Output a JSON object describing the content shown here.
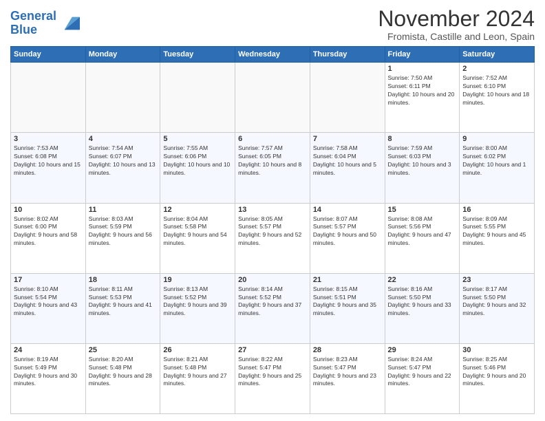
{
  "header": {
    "logo_line1": "General",
    "logo_line2": "Blue",
    "month": "November 2024",
    "location": "Fromista, Castille and Leon, Spain"
  },
  "weekdays": [
    "Sunday",
    "Monday",
    "Tuesday",
    "Wednesday",
    "Thursday",
    "Friday",
    "Saturday"
  ],
  "weeks": [
    [
      {
        "day": "",
        "info": ""
      },
      {
        "day": "",
        "info": ""
      },
      {
        "day": "",
        "info": ""
      },
      {
        "day": "",
        "info": ""
      },
      {
        "day": "",
        "info": ""
      },
      {
        "day": "1",
        "info": "Sunrise: 7:50 AM\nSunset: 6:11 PM\nDaylight: 10 hours and 20 minutes."
      },
      {
        "day": "2",
        "info": "Sunrise: 7:52 AM\nSunset: 6:10 PM\nDaylight: 10 hours and 18 minutes."
      }
    ],
    [
      {
        "day": "3",
        "info": "Sunrise: 7:53 AM\nSunset: 6:08 PM\nDaylight: 10 hours and 15 minutes."
      },
      {
        "day": "4",
        "info": "Sunrise: 7:54 AM\nSunset: 6:07 PM\nDaylight: 10 hours and 13 minutes."
      },
      {
        "day": "5",
        "info": "Sunrise: 7:55 AM\nSunset: 6:06 PM\nDaylight: 10 hours and 10 minutes."
      },
      {
        "day": "6",
        "info": "Sunrise: 7:57 AM\nSunset: 6:05 PM\nDaylight: 10 hours and 8 minutes."
      },
      {
        "day": "7",
        "info": "Sunrise: 7:58 AM\nSunset: 6:04 PM\nDaylight: 10 hours and 5 minutes."
      },
      {
        "day": "8",
        "info": "Sunrise: 7:59 AM\nSunset: 6:03 PM\nDaylight: 10 hours and 3 minutes."
      },
      {
        "day": "9",
        "info": "Sunrise: 8:00 AM\nSunset: 6:02 PM\nDaylight: 10 hours and 1 minute."
      }
    ],
    [
      {
        "day": "10",
        "info": "Sunrise: 8:02 AM\nSunset: 6:00 PM\nDaylight: 9 hours and 58 minutes."
      },
      {
        "day": "11",
        "info": "Sunrise: 8:03 AM\nSunset: 5:59 PM\nDaylight: 9 hours and 56 minutes."
      },
      {
        "day": "12",
        "info": "Sunrise: 8:04 AM\nSunset: 5:58 PM\nDaylight: 9 hours and 54 minutes."
      },
      {
        "day": "13",
        "info": "Sunrise: 8:05 AM\nSunset: 5:57 PM\nDaylight: 9 hours and 52 minutes."
      },
      {
        "day": "14",
        "info": "Sunrise: 8:07 AM\nSunset: 5:57 PM\nDaylight: 9 hours and 50 minutes."
      },
      {
        "day": "15",
        "info": "Sunrise: 8:08 AM\nSunset: 5:56 PM\nDaylight: 9 hours and 47 minutes."
      },
      {
        "day": "16",
        "info": "Sunrise: 8:09 AM\nSunset: 5:55 PM\nDaylight: 9 hours and 45 minutes."
      }
    ],
    [
      {
        "day": "17",
        "info": "Sunrise: 8:10 AM\nSunset: 5:54 PM\nDaylight: 9 hours and 43 minutes."
      },
      {
        "day": "18",
        "info": "Sunrise: 8:11 AM\nSunset: 5:53 PM\nDaylight: 9 hours and 41 minutes."
      },
      {
        "day": "19",
        "info": "Sunrise: 8:13 AM\nSunset: 5:52 PM\nDaylight: 9 hours and 39 minutes."
      },
      {
        "day": "20",
        "info": "Sunrise: 8:14 AM\nSunset: 5:52 PM\nDaylight: 9 hours and 37 minutes."
      },
      {
        "day": "21",
        "info": "Sunrise: 8:15 AM\nSunset: 5:51 PM\nDaylight: 9 hours and 35 minutes."
      },
      {
        "day": "22",
        "info": "Sunrise: 8:16 AM\nSunset: 5:50 PM\nDaylight: 9 hours and 33 minutes."
      },
      {
        "day": "23",
        "info": "Sunrise: 8:17 AM\nSunset: 5:50 PM\nDaylight: 9 hours and 32 minutes."
      }
    ],
    [
      {
        "day": "24",
        "info": "Sunrise: 8:19 AM\nSunset: 5:49 PM\nDaylight: 9 hours and 30 minutes."
      },
      {
        "day": "25",
        "info": "Sunrise: 8:20 AM\nSunset: 5:48 PM\nDaylight: 9 hours and 28 minutes."
      },
      {
        "day": "26",
        "info": "Sunrise: 8:21 AM\nSunset: 5:48 PM\nDaylight: 9 hours and 27 minutes."
      },
      {
        "day": "27",
        "info": "Sunrise: 8:22 AM\nSunset: 5:47 PM\nDaylight: 9 hours and 25 minutes."
      },
      {
        "day": "28",
        "info": "Sunrise: 8:23 AM\nSunset: 5:47 PM\nDaylight: 9 hours and 23 minutes."
      },
      {
        "day": "29",
        "info": "Sunrise: 8:24 AM\nSunset: 5:47 PM\nDaylight: 9 hours and 22 minutes."
      },
      {
        "day": "30",
        "info": "Sunrise: 8:25 AM\nSunset: 5:46 PM\nDaylight: 9 hours and 20 minutes."
      }
    ]
  ]
}
